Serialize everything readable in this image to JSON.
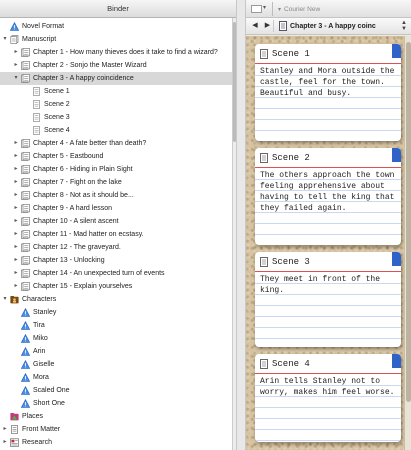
{
  "binder": {
    "header": "Binder",
    "items": [
      {
        "label": "Novel Format",
        "icon": "warning-triangle-icon",
        "level": 0,
        "toggle": ""
      },
      {
        "label": "Manuscript",
        "icon": "stack-icon",
        "level": 0,
        "toggle": "▾"
      },
      {
        "label": "Chapter 1 - How many thieves does it take to find a wizard?",
        "icon": "folder-icon",
        "level": 1,
        "toggle": "▸"
      },
      {
        "label": "Chapter 2 - Sonjo the Master Wizard",
        "icon": "folder-icon",
        "level": 1,
        "toggle": "▸"
      },
      {
        "label": "Chapter 3 - A happy coincidence",
        "icon": "folder-icon",
        "level": 1,
        "toggle": "▾",
        "selected": true
      },
      {
        "label": "Scene 1",
        "icon": "doc-icon",
        "level": 2,
        "toggle": ""
      },
      {
        "label": "Scene 2",
        "icon": "doc-icon",
        "level": 2,
        "toggle": ""
      },
      {
        "label": "Scene 3",
        "icon": "doc-icon",
        "level": 2,
        "toggle": ""
      },
      {
        "label": "Scene 4",
        "icon": "doc-icon",
        "level": 2,
        "toggle": ""
      },
      {
        "label": "Chapter 4 - A fate better than death?",
        "icon": "folder-icon",
        "level": 1,
        "toggle": "▸"
      },
      {
        "label": "Chapter 5 - Eastbound",
        "icon": "folder-icon",
        "level": 1,
        "toggle": "▸"
      },
      {
        "label": "Chapter 6 - Hiding in Plain Sight",
        "icon": "folder-icon",
        "level": 1,
        "toggle": "▸"
      },
      {
        "label": "Chapter 7 - Fight on the lake",
        "icon": "folder-icon",
        "level": 1,
        "toggle": "▸"
      },
      {
        "label": "Chapter 8 - Not as it should be...",
        "icon": "folder-icon",
        "level": 1,
        "toggle": "▸"
      },
      {
        "label": "Chapter 9 - A hard lesson",
        "icon": "folder-icon",
        "level": 1,
        "toggle": "▸"
      },
      {
        "label": "Chapter 10 - A silent ascent",
        "icon": "folder-icon",
        "level": 1,
        "toggle": "▸"
      },
      {
        "label": "Chapter 11 - Mad hatter on ecstasy.",
        "icon": "folder-icon",
        "level": 1,
        "toggle": "▸"
      },
      {
        "label": "Chapter 12 - The graveyard.",
        "icon": "folder-icon",
        "level": 1,
        "toggle": "▸"
      },
      {
        "label": "Chapter 13 - Unlocking",
        "icon": "folder-icon",
        "level": 1,
        "toggle": "▸"
      },
      {
        "label": "Chapter 14 - An unexpected turn of events",
        "icon": "folder-icon",
        "level": 1,
        "toggle": "▸"
      },
      {
        "label": "Chapter 15 - Explain yourselves",
        "icon": "folder-icon",
        "level": 1,
        "toggle": "▸"
      },
      {
        "label": "Characters",
        "icon": "characters-folder-icon",
        "level": 0,
        "toggle": "▾"
      },
      {
        "label": "Stanley",
        "icon": "warning-triangle-icon",
        "level": 1,
        "toggle": ""
      },
      {
        "label": "Tira",
        "icon": "warning-triangle-icon",
        "level": 1,
        "toggle": ""
      },
      {
        "label": "Miko",
        "icon": "warning-triangle-icon",
        "level": 1,
        "toggle": ""
      },
      {
        "label": "Arin",
        "icon": "warning-triangle-icon",
        "level": 1,
        "toggle": ""
      },
      {
        "label": "Giselle",
        "icon": "warning-triangle-icon",
        "level": 1,
        "toggle": ""
      },
      {
        "label": "Mora",
        "icon": "warning-triangle-icon",
        "level": 1,
        "toggle": ""
      },
      {
        "label": "Scaled One",
        "icon": "warning-triangle-icon",
        "level": 1,
        "toggle": ""
      },
      {
        "label": "Short One",
        "icon": "warning-triangle-icon",
        "level": 1,
        "toggle": ""
      },
      {
        "label": "Places",
        "icon": "places-folder-icon",
        "level": 0,
        "toggle": ""
      },
      {
        "label": "Front Matter",
        "icon": "folder-doc-icon",
        "level": 0,
        "toggle": "▸"
      },
      {
        "label": "Research",
        "icon": "research-icon",
        "level": 0,
        "toggle": "▸"
      }
    ]
  },
  "toolbar": {
    "font_name": "Courier New"
  },
  "navbar": {
    "back": "◀",
    "forward": "▶",
    "title": "Chapter 3 - A happy coinc"
  },
  "cards": [
    {
      "title": "Scene 1",
      "text": "Stanley and Mora outside the castle, feel for the town. Beautiful and busy."
    },
    {
      "title": "Scene 2",
      "text": "The others approach the town feeling apprehensive about having to tell the king that they failed again."
    },
    {
      "title": "Scene 3",
      "text": "They meet in front of the king."
    },
    {
      "title": "Scene 4",
      "text": "Arin tells Stanley not to worry, makes him feel worse."
    }
  ],
  "colors": {
    "selected_row": "#d8d8d8",
    "card_tab": "#2f63c8",
    "card_rule": "#d9534f",
    "cork": "#d6c3a1"
  }
}
